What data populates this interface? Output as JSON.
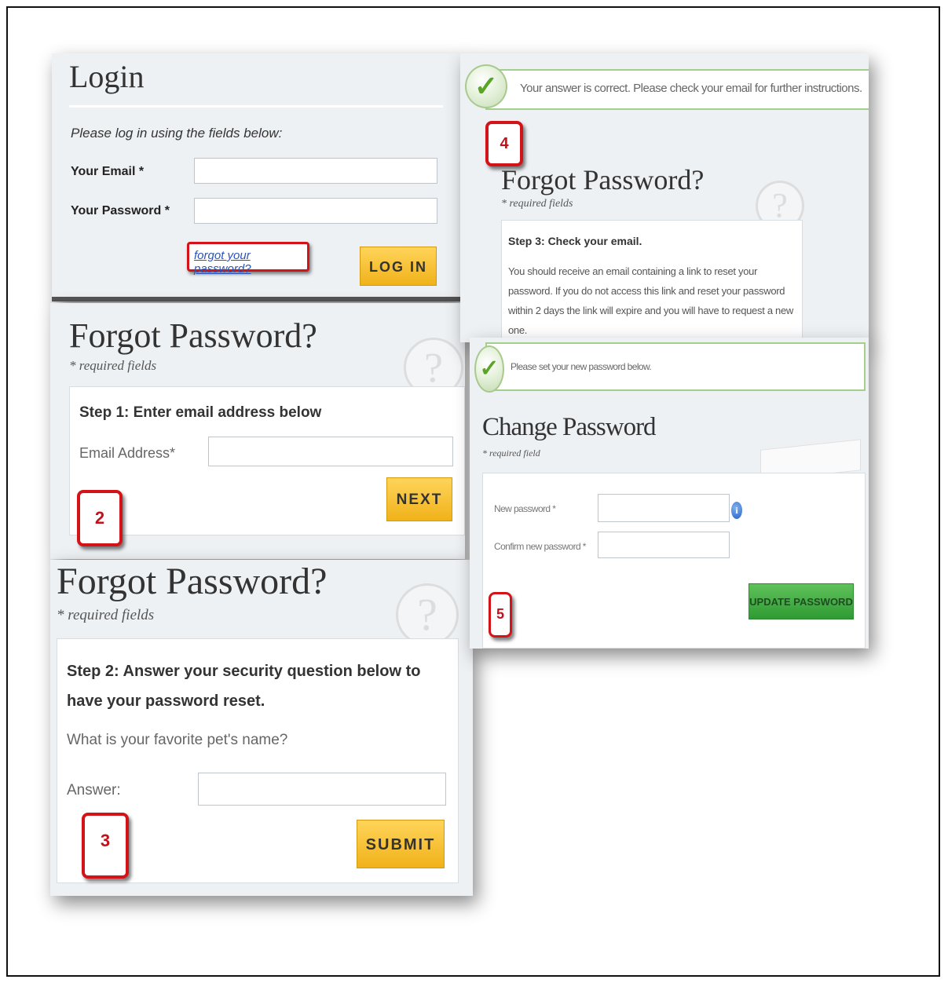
{
  "login": {
    "title": "Login",
    "subtitle": "Please log in using the fields below:",
    "email_label": "Your Email *",
    "password_label": "Your Password *",
    "forgot_link": "forgot your password?",
    "login_button": "LOG IN"
  },
  "step2_panel": {
    "title": "Forgot Password?",
    "required": "* required fields",
    "step_heading": "Step 1: Enter email address below",
    "email_label": "Email Address*",
    "next_button": "NEXT",
    "badge": "2"
  },
  "step3_panel": {
    "title": "Forgot Password?",
    "required": "* required fields",
    "step_heading": "Step 2: Answer your security question below to have your password reset.",
    "question": "What is your favorite pet's name?",
    "answer_label": "Answer:",
    "submit_button": "SUBMIT",
    "badge": "3"
  },
  "step4_panel": {
    "message": "Your answer is correct. Please check your email for further instructions.",
    "badge": "4",
    "title": "Forgot Password?",
    "required": "* required fields",
    "step_heading": "Step 3: Check your email.",
    "body": "You should receive an email containing a link to reset your password. If you do not access this link and reset your password within 2 days the link will expire and you will have to request a new one."
  },
  "step5_panel": {
    "message": "Please set your new password below.",
    "title": "Change Password",
    "required": "* required field",
    "new_password_label": "New password *",
    "confirm_password_label": "Confirm new password *",
    "update_button": "UPDATE PASSWORD",
    "badge": "5"
  },
  "icons": {
    "check": "check-circle-icon",
    "question": "question-mark-icon",
    "info": "info-icon"
  }
}
